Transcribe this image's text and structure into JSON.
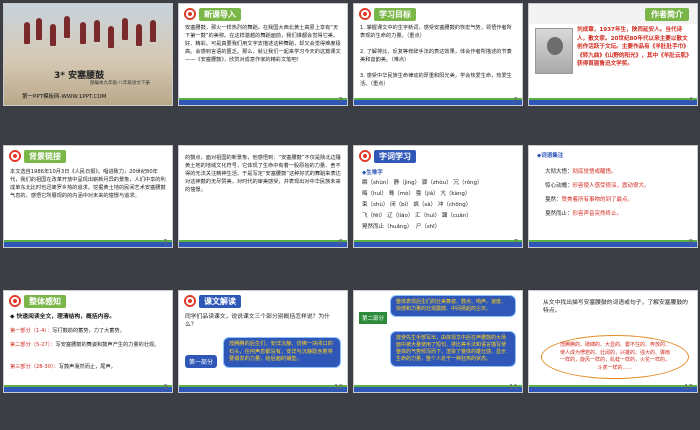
{
  "slides": [
    {
      "num": "",
      "title": "3* 安塞腰鼓",
      "subtitle": "部编本九年级·八年级语文下册",
      "footer": "第一PPT模板网-WWW.1PPT.COM"
    },
    {
      "num": "2",
      "tag": "新课导入",
      "text": "安塞腰鼓，那火一样热烈的舞蹈，在我国大西北黄土高原上享有“天下第一鼓”的美称。在这样激越的舞蹈面前，我们谁都会觉得它美、好、精彩。可是真要我们用文字去描述这种舞蹈，却又会觉得难度极高。会感到言语的匮乏。那么，就让我们一起来学习今天的这篇课文——《安塞腰鼓》，欣赏对成意作家的精彩文笔吧！"
    },
    {
      "num": "3",
      "tag": "学习目标",
      "items": [
        "1. 掌握课文中的生字新词，感受安塞腰鼓的恢宏气势，领悟作者所表现的生命的力量。（重点）",
        "2. 了解排比、反复等修辞手法的表达效果，体会作者所描述的节奏美和音韵美。（难点）",
        "3. 感受中华民族生命律动的厚重和阳光美，学会热爱生命，热爱生活。（重点）"
      ],
      "mark": "（重点）"
    },
    {
      "num": "4",
      "tag": "作者简介",
      "text": "刘成章，1937年生，陕西延安人。当代诗人，散文家。20世纪80年代以来主要以散文创作活跃于文坛。主要作品有《羊肚肚手巾》《转九曲》《山野的阳光》，其中《羊肚云肌》获得首届鲁迅文学奖。"
    },
    {
      "num": "5",
      "tag": "背景链接",
      "text": "本文选自1986年10月3日《人民日报》。唱进致力，20世纪80年代，我们的祖国在改革开放中呈现出崭新月异的景象，人们中享的利成单东北比时也迅离罗乡热的追求。挖掘黄土地的民间艺术安塞腰鼓气息的、感悟它所展现的的内涵中对未来的憧憬与追求。"
    },
    {
      "num": "6",
      "text": "的鼓点，面对祖国的新景象，他感悟到：“安塞腰鼓”不仅是陕北边陲黄土地的地域文化符号，它体现了生命中有着一股原始的力量、舍不得的无法关注精神生活，于是写定“安塞腰鼓”这种好式的舞蹈来表达对这神鼓的无尽赞美，对时代的审美感受，并表现出对中华民族未来的憧憬。"
    },
    {
      "num": "7",
      "tag": "字词学习",
      "section": "◆生难字",
      "rows": [
        [
          "瞬（shùn）",
          "静（jìng）",
          "骤（zhòu）",
          "冗（rǒng）"
        ],
        [
          "晦（huì）",
          "蓦（mò）",
          "戛（jiá）",
          "亢（kàng）"
        ],
        [
          "束（shù）",
          "闭（bì）",
          "飒（sà）",
          "冲（chōng）"
        ],
        [
          "飞（fēi）",
          "辽（liáo）",
          "汇（huì）",
          "蹿（cuān）"
        ],
        [
          "晃然而止（huǎng）",
          "",
          "尸（shī）",
          ""
        ]
      ]
    },
    {
      "num": "8",
      "section": "◆词语集注",
      "entries": [
        {
          "word": "大彻大悟：",
          "def": "彻底觉悟或醒悟。"
        },
        {
          "word": "惊心动魄：",
          "def": "形容使人感受很深，震动很大。"
        },
        {
          "word": "戛然：",
          "def": ""
        },
        {
          "word": "戛然而止：",
          "def": "形容声音突然终止。"
        }
      ],
      "extra": "赞美着所有事物的到了最点。"
    },
    {
      "num": "9",
      "tag": "整体感知",
      "lead": "◆ 快速阅读全文，理清结构，概括内容。",
      "parts": [
        {
          "label": "第一部分（1-4）：",
          "text": "写打鼓前的蓄势，力了大蓄势。"
        },
        {
          "label": "第二部分（5-27）：",
          "text": "写安塞腰鼓的舞姿和鼓声产生的力量的壮观。"
        },
        {
          "label": "第三部分（28-30）：",
          "text": "写鼓声戛然而止，尾声。"
        }
      ]
    },
    {
      "num": "10",
      "tag": "课文解读",
      "question": "同学们品读课文，说说课文三个部分别概括怎样说？为什么？",
      "part": "第一部分",
      "bubble": "茂腾腾的后生们，安详沉静、仿佛一块闭口的石头，任何声息都没有，安详与沉静隐含着将要爆发的力量，给后面的铺垫。"
    },
    {
      "num": "11",
      "part": "第二部分",
      "top": "整体表现后生们的壮美舞姿、鼓点、响声、速度、快感和力量的壮观震撼、中间扬起的尘灰。",
      "bubble": "放使先生手部写出，由体现文中后在声腰鼓的大场面中被大量使用了短句、排比等手法和语言描写使整体的气势倾泻而下，渲染了整体的雄壮感，显示生命的力量，整个人处于一种狂热的状态。"
    },
    {
      "num": "12",
      "question": "从文中找出描写安塞腰鼓的词语或句子，了解安塞腰鼓的特点。",
      "text": "茂腾腾的、磅礴的、大显的、霎不住的、奔放的、使人成为愣若的、壮阔的，兴雄的、强大的、骤雨一样的，旋风一样的，乱蛙一样的，火花一样的，斗虎一样的……"
    }
  ],
  "colors": {
    "accent_green": "#7ab648",
    "accent_blue": "#2f57b8",
    "text_red": "#d12a1f"
  }
}
